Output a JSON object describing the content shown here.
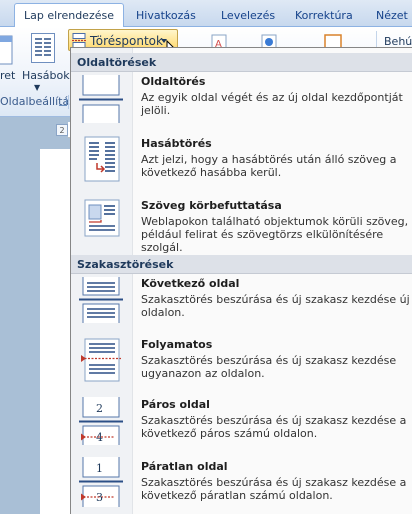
{
  "tabs": {
    "active": "Lap elrendezése",
    "items": [
      "Hivatkozás",
      "Levelezés",
      "Korrektúra",
      "Nézet"
    ]
  },
  "ribbon": {
    "margins_label": "ret",
    "columns_label": "Hasábok",
    "group_label": "Oldalbeállítás",
    "breaks_button": "Töréspontok",
    "right_label": "Behú"
  },
  "ruler": {
    "box": "2"
  },
  "menu": {
    "sections": [
      {
        "header": "Oldaltörések",
        "items": [
          {
            "title": "Oldaltörés",
            "desc": "Az egyik oldal végét és az új oldal kezdőpontját jelöli.",
            "icon": "page-break-icon"
          },
          {
            "title": "Hasábtörés",
            "desc": "Azt jelzi, hogy a hasábtörés után álló szöveg a következő hasábba kerül.",
            "icon": "column-break-icon"
          },
          {
            "title": "Szöveg körbefuttatása",
            "desc": "Weblapokon található objektumok körüli szöveg, például felirat és szövegtörzs elkülönítésére szolgál.",
            "icon": "text-wrapping-icon"
          }
        ]
      },
      {
        "header": "Szakasztörések",
        "items": [
          {
            "title": "Következő oldal",
            "desc": "Szakasztörés beszúrása és új szakasz kezdése új oldalon.",
            "icon": "next-page-icon"
          },
          {
            "title": "Folyamatos",
            "desc": "Szakasztörés beszúrása és új szakasz kezdése ugyanazon az oldalon.",
            "icon": "continuous-icon"
          },
          {
            "title": "Páros oldal",
            "desc": "Szakasztörés beszúrása és új szakasz kezdése a következő páros számú oldalon.",
            "icon": "even-page-icon",
            "numbers": [
              "2",
              "4"
            ]
          },
          {
            "title": "Páratlan oldal",
            "desc": "Szakasztörés beszúrása és új szakasz kezdése a következő páratlan számú oldalon.",
            "icon": "odd-page-icon",
            "numbers": [
              "1",
              "3"
            ]
          }
        ]
      }
    ]
  }
}
